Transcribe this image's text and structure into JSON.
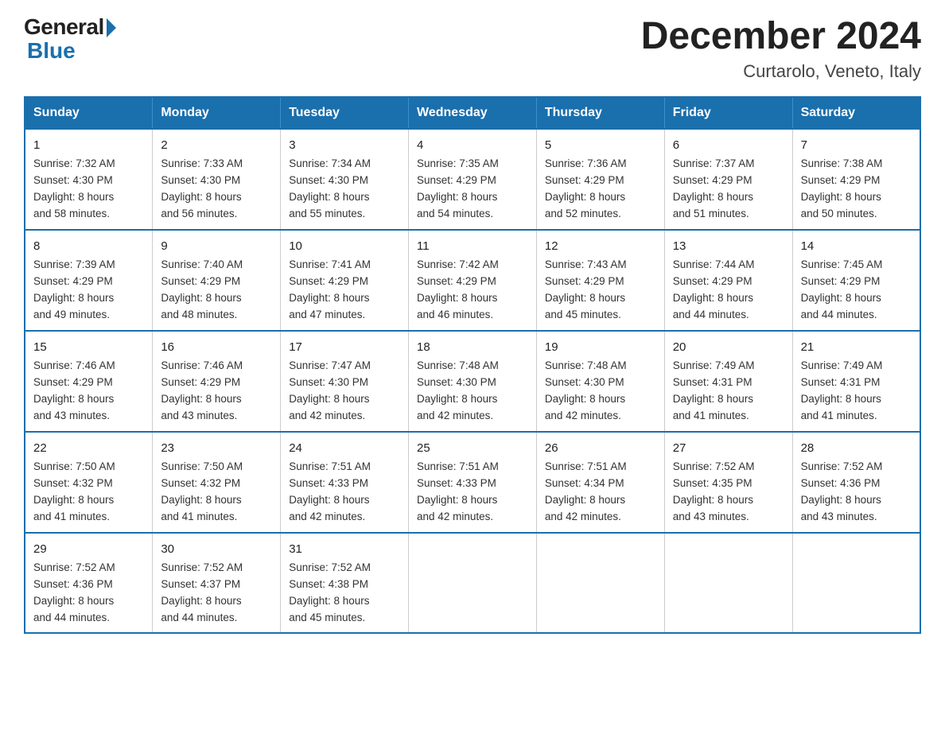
{
  "logo": {
    "general": "General",
    "blue": "Blue"
  },
  "header": {
    "month": "December 2024",
    "location": "Curtarolo, Veneto, Italy"
  },
  "weekdays": [
    "Sunday",
    "Monday",
    "Tuesday",
    "Wednesday",
    "Thursday",
    "Friday",
    "Saturday"
  ],
  "weeks": [
    [
      {
        "day": "1",
        "sunrise": "7:32 AM",
        "sunset": "4:30 PM",
        "daylight": "8 hours and 58 minutes."
      },
      {
        "day": "2",
        "sunrise": "7:33 AM",
        "sunset": "4:30 PM",
        "daylight": "8 hours and 56 minutes."
      },
      {
        "day": "3",
        "sunrise": "7:34 AM",
        "sunset": "4:30 PM",
        "daylight": "8 hours and 55 minutes."
      },
      {
        "day": "4",
        "sunrise": "7:35 AM",
        "sunset": "4:29 PM",
        "daylight": "8 hours and 54 minutes."
      },
      {
        "day": "5",
        "sunrise": "7:36 AM",
        "sunset": "4:29 PM",
        "daylight": "8 hours and 52 minutes."
      },
      {
        "day": "6",
        "sunrise": "7:37 AM",
        "sunset": "4:29 PM",
        "daylight": "8 hours and 51 minutes."
      },
      {
        "day": "7",
        "sunrise": "7:38 AM",
        "sunset": "4:29 PM",
        "daylight": "8 hours and 50 minutes."
      }
    ],
    [
      {
        "day": "8",
        "sunrise": "7:39 AM",
        "sunset": "4:29 PM",
        "daylight": "8 hours and 49 minutes."
      },
      {
        "day": "9",
        "sunrise": "7:40 AM",
        "sunset": "4:29 PM",
        "daylight": "8 hours and 48 minutes."
      },
      {
        "day": "10",
        "sunrise": "7:41 AM",
        "sunset": "4:29 PM",
        "daylight": "8 hours and 47 minutes."
      },
      {
        "day": "11",
        "sunrise": "7:42 AM",
        "sunset": "4:29 PM",
        "daylight": "8 hours and 46 minutes."
      },
      {
        "day": "12",
        "sunrise": "7:43 AM",
        "sunset": "4:29 PM",
        "daylight": "8 hours and 45 minutes."
      },
      {
        "day": "13",
        "sunrise": "7:44 AM",
        "sunset": "4:29 PM",
        "daylight": "8 hours and 44 minutes."
      },
      {
        "day": "14",
        "sunrise": "7:45 AM",
        "sunset": "4:29 PM",
        "daylight": "8 hours and 44 minutes."
      }
    ],
    [
      {
        "day": "15",
        "sunrise": "7:46 AM",
        "sunset": "4:29 PM",
        "daylight": "8 hours and 43 minutes."
      },
      {
        "day": "16",
        "sunrise": "7:46 AM",
        "sunset": "4:29 PM",
        "daylight": "8 hours and 43 minutes."
      },
      {
        "day": "17",
        "sunrise": "7:47 AM",
        "sunset": "4:30 PM",
        "daylight": "8 hours and 42 minutes."
      },
      {
        "day": "18",
        "sunrise": "7:48 AM",
        "sunset": "4:30 PM",
        "daylight": "8 hours and 42 minutes."
      },
      {
        "day": "19",
        "sunrise": "7:48 AM",
        "sunset": "4:30 PM",
        "daylight": "8 hours and 42 minutes."
      },
      {
        "day": "20",
        "sunrise": "7:49 AM",
        "sunset": "4:31 PM",
        "daylight": "8 hours and 41 minutes."
      },
      {
        "day": "21",
        "sunrise": "7:49 AM",
        "sunset": "4:31 PM",
        "daylight": "8 hours and 41 minutes."
      }
    ],
    [
      {
        "day": "22",
        "sunrise": "7:50 AM",
        "sunset": "4:32 PM",
        "daylight": "8 hours and 41 minutes."
      },
      {
        "day": "23",
        "sunrise": "7:50 AM",
        "sunset": "4:32 PM",
        "daylight": "8 hours and 41 minutes."
      },
      {
        "day": "24",
        "sunrise": "7:51 AM",
        "sunset": "4:33 PM",
        "daylight": "8 hours and 42 minutes."
      },
      {
        "day": "25",
        "sunrise": "7:51 AM",
        "sunset": "4:33 PM",
        "daylight": "8 hours and 42 minutes."
      },
      {
        "day": "26",
        "sunrise": "7:51 AM",
        "sunset": "4:34 PM",
        "daylight": "8 hours and 42 minutes."
      },
      {
        "day": "27",
        "sunrise": "7:52 AM",
        "sunset": "4:35 PM",
        "daylight": "8 hours and 43 minutes."
      },
      {
        "day": "28",
        "sunrise": "7:52 AM",
        "sunset": "4:36 PM",
        "daylight": "8 hours and 43 minutes."
      }
    ],
    [
      {
        "day": "29",
        "sunrise": "7:52 AM",
        "sunset": "4:36 PM",
        "daylight": "8 hours and 44 minutes."
      },
      {
        "day": "30",
        "sunrise": "7:52 AM",
        "sunset": "4:37 PM",
        "daylight": "8 hours and 44 minutes."
      },
      {
        "day": "31",
        "sunrise": "7:52 AM",
        "sunset": "4:38 PM",
        "daylight": "8 hours and 45 minutes."
      },
      null,
      null,
      null,
      null
    ]
  ],
  "labels": {
    "sunrise": "Sunrise:",
    "sunset": "Sunset:",
    "daylight": "Daylight:"
  }
}
